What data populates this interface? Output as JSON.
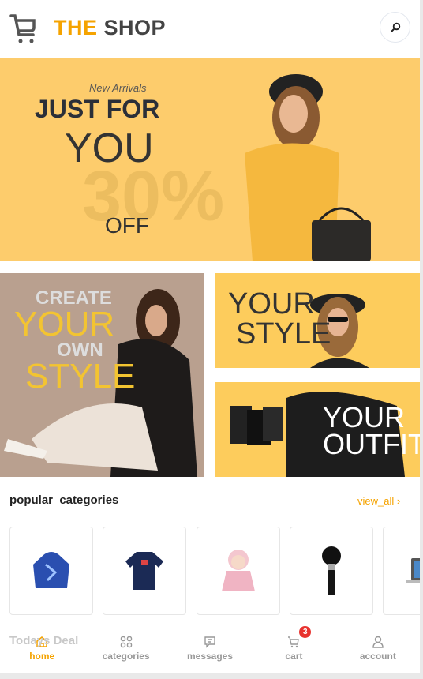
{
  "header": {
    "brand_part1": "THE",
    "brand_part2": "SHOP",
    "logo_icon": "cart-icon",
    "search_icon": "search-icon"
  },
  "banner": {
    "subtitle": "New Arrivals",
    "line1": "JUST FOR",
    "line2": "YOU",
    "discount": "30%",
    "off": "OFF",
    "bg": "#fdcc6c"
  },
  "tiles": [
    {
      "line1": "CREATE",
      "line2": "YOUR",
      "line3": "OWN",
      "line4": "STYLE"
    },
    {
      "line1": "YOUR",
      "line2": "STYLE"
    },
    {
      "line1": "YOUR",
      "line2": "OUTFIT"
    }
  ],
  "popular": {
    "title": "popular_categories",
    "view_all": "view_all"
  },
  "categories": [
    {
      "icon": "hoodie-image"
    },
    {
      "icon": "jersey-image"
    },
    {
      "icon": "doll-image"
    },
    {
      "icon": "makeup-brush-image"
    },
    {
      "icon": "laptop-image"
    }
  ],
  "todays_deal": "Todays Deal",
  "nav": {
    "items": [
      {
        "label": "home",
        "icon": "home-icon"
      },
      {
        "label": "categories",
        "icon": "grid-icon"
      },
      {
        "label": "messages",
        "icon": "message-icon"
      },
      {
        "label": "cart",
        "icon": "cart-icon",
        "badge": "3"
      },
      {
        "label": "account",
        "icon": "user-icon"
      }
    ]
  },
  "colors": {
    "accent": "#f5a300",
    "badge": "#e8322e"
  }
}
